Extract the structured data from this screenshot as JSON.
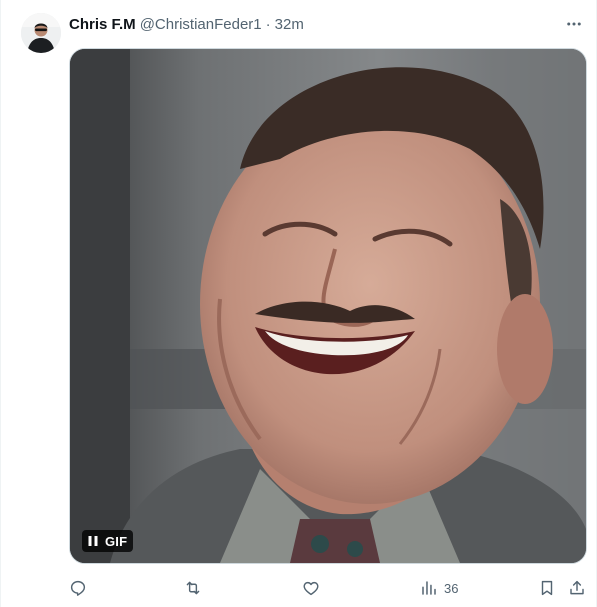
{
  "tweet": {
    "author": {
      "display_name": "Chris F.M",
      "handle": "@ChristianFeder1",
      "avatar_icon": "user-avatar"
    },
    "separator": "·",
    "time": "32m",
    "more_icon": "more-horizontal-icon",
    "media": {
      "type": "gif",
      "badge_label": "GIF",
      "control_icon": "pause-icon",
      "description_icon": "laughing-man-gif"
    },
    "actions": {
      "reply_icon": "reply-icon",
      "retweet_icon": "retweet-icon",
      "like_icon": "heart-icon",
      "views_icon": "views-chart-icon",
      "views_count": "36",
      "bookmark_icon": "bookmark-icon",
      "share_icon": "share-icon"
    }
  },
  "colors": {
    "text_primary": "#0f1419",
    "text_secondary": "#536471",
    "border": "#cfd9de",
    "gif_badge_bg": "#000000"
  }
}
